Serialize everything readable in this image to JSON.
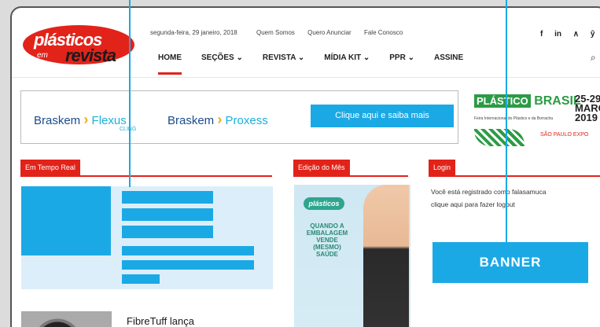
{
  "header": {
    "logo_top": "plásticos",
    "logo_bottom": "revista",
    "logo_em": "em",
    "date": "segunda-feira, 29 janeiro, 2018",
    "links": [
      "Quem Somos",
      "Quero Anunciar",
      "Fale Conosco"
    ],
    "social": [
      "f",
      "in",
      "∧",
      "ŷ"
    ]
  },
  "nav": {
    "items": [
      "HOME",
      "SEÇÕES ⌄",
      "REVISTA ⌄",
      "MÍDIA KIT ⌄",
      "PPR ⌄",
      "ASSINE"
    ],
    "search_icon": "⌕"
  },
  "ad": {
    "brand1": "Braskem",
    "prod1": "Flexus",
    "prod1_sub": "CLING",
    "brand2": "Braskem",
    "prod2": "Proxess",
    "cta": "Clique aqui e saiba mais"
  },
  "sponsor": {
    "tag": "PLÁSTICO",
    "word": "BRASIL",
    "dates": "25-29\nMARÇO\n2019",
    "feira": "Feira Internacional do Plástico e da Borracha",
    "expo": "SÃO PAULO EXPO"
  },
  "sections": {
    "realtime": "Em Tempo Real",
    "edition": "Edição do Mês",
    "login": "Login"
  },
  "login_text": [
    "Você está registrado como falasamuca",
    "clique aqui para fazer logout"
  ],
  "magazine": {
    "logo": "plásticos",
    "headline": "QUANDO A EMBALAGEM VENDE (MESMO) SAÚDE"
  },
  "banner_label": "BANNER",
  "article": {
    "title": "FibreTuff lança"
  },
  "colors": {
    "accent": "#e2231a",
    "callout": "#1ba9e6"
  }
}
